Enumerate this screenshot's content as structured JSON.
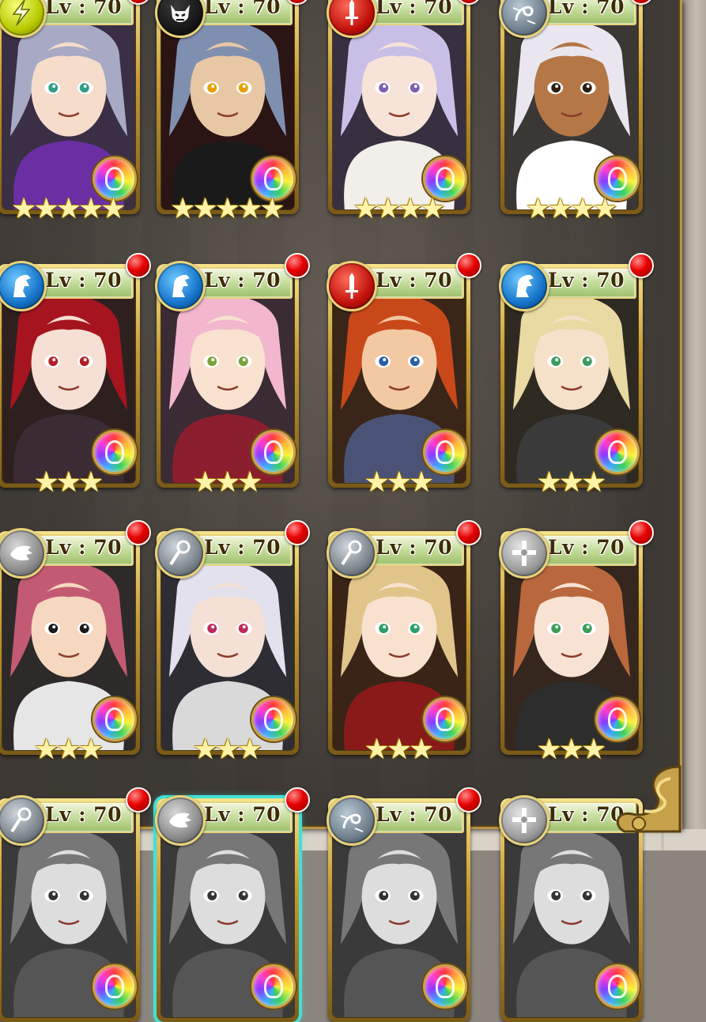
{
  "screen": "unit-roster",
  "level_prefix": "Lv",
  "colors": {
    "accent_gold": "#c79b34",
    "notification_red": "#e60000",
    "selection_cyan": "#41e0d6"
  },
  "units": [
    {
      "id": "u1",
      "level": "Lv : 70",
      "class": "lightning",
      "stars": 5,
      "notification": true,
      "portrait": "purple-visor-girl"
    },
    {
      "id": "u2",
      "level": "Lv : 70",
      "class": "demon",
      "stars": 5,
      "notification": true,
      "portrait": "masked-dark-knight"
    },
    {
      "id": "u3",
      "level": "Lv : 70",
      "class": "sword",
      "stars": 4,
      "notification": true,
      "portrait": "eyepatch-lavender-hair"
    },
    {
      "id": "u4",
      "level": "Lv : 70",
      "class": "mage",
      "stars": 4,
      "notification": true,
      "portrait": "white-hair-priest"
    },
    {
      "id": "u5",
      "level": "Lv : 70",
      "class": "knight",
      "stars": 3,
      "notification": true,
      "portrait": "crimson-hair-girl"
    },
    {
      "id": "u6",
      "level": "Lv : 70",
      "class": "knight",
      "stars": 3,
      "notification": true,
      "portrait": "pink-hair-swordsman"
    },
    {
      "id": "u7",
      "level": "Lv : 70",
      "class": "sword",
      "stars": 3,
      "notification": true,
      "portrait": "orange-hair-hero"
    },
    {
      "id": "u8",
      "level": "Lv : 70",
      "class": "knight",
      "stars": 3,
      "notification": true,
      "portrait": "blonde-long-hair"
    },
    {
      "id": "u9",
      "level": "Lv : 70",
      "class": "dragon",
      "stars": 3,
      "notification": true,
      "portrait": "pink-hair-grin"
    },
    {
      "id": "u10",
      "level": "Lv : 70",
      "class": "staff",
      "stars": 3,
      "notification": true,
      "portrait": "white-hair-glasses"
    },
    {
      "id": "u11",
      "level": "Lv : 70",
      "class": "staff",
      "stars": 3,
      "notification": true,
      "portrait": "blonde-curls-girl"
    },
    {
      "id": "u12",
      "level": "Lv : 70",
      "class": "cross",
      "stars": 3,
      "notification": true,
      "portrait": "auburn-hair-smile"
    },
    {
      "id": "u13",
      "level": "Lv : 70",
      "class": "staff",
      "stars": 0,
      "notification": true,
      "portrait": "partial"
    },
    {
      "id": "u14",
      "level": "Lv : 70",
      "class": "dragon",
      "stars": 0,
      "notification": true,
      "portrait": "partial",
      "selected": true
    },
    {
      "id": "u15",
      "level": "Lv : 70",
      "class": "mage",
      "stars": 0,
      "notification": true,
      "portrait": "partial"
    },
    {
      "id": "u16",
      "level": "Lv : 70",
      "class": "cross",
      "stars": 0,
      "notification": false,
      "portrait": "partial"
    }
  ]
}
